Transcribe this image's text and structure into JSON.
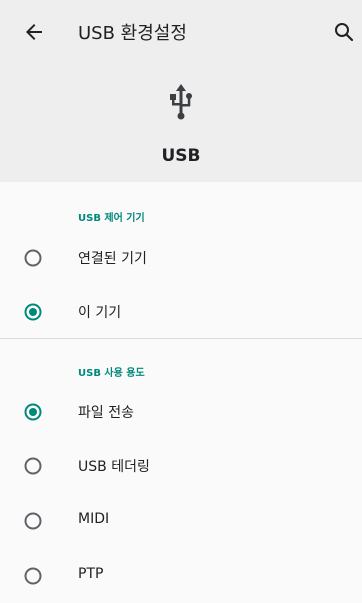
{
  "topbar": {
    "title": "USB 환경설정",
    "back_icon": "arrow-back-icon",
    "search_icon": "search-icon"
  },
  "header": {
    "icon": "usb-icon",
    "label": "USB"
  },
  "sections": [
    {
      "title": "USB 제어 기기",
      "options": [
        {
          "label": "연결된 기기",
          "selected": false
        },
        {
          "label": "이 기기",
          "selected": true
        }
      ]
    },
    {
      "title": "USB 사용 용도",
      "options": [
        {
          "label": "파일 전송",
          "selected": true
        },
        {
          "label": "USB 테더링",
          "selected": false
        },
        {
          "label": "MIDI",
          "selected": false
        },
        {
          "label": "PTP",
          "selected": false
        }
      ]
    }
  ],
  "colors": {
    "accent": "#00897b",
    "radio_off": "#5f6368",
    "header_bg": "#eeeeee",
    "page_bg": "#fafafa"
  }
}
